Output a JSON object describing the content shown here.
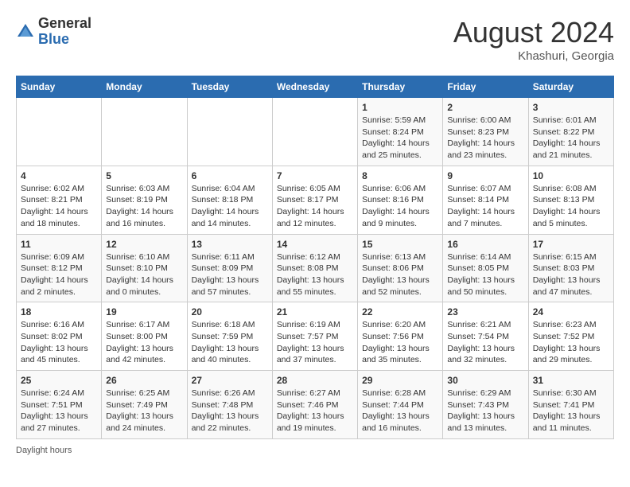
{
  "header": {
    "logo_general": "General",
    "logo_blue": "Blue",
    "month_year": "August 2024",
    "location": "Khashuri, Georgia"
  },
  "days_of_week": [
    "Sunday",
    "Monday",
    "Tuesday",
    "Wednesday",
    "Thursday",
    "Friday",
    "Saturday"
  ],
  "weeks": [
    [
      {
        "day": "",
        "sunrise": "",
        "sunset": "",
        "daylight": ""
      },
      {
        "day": "",
        "sunrise": "",
        "sunset": "",
        "daylight": ""
      },
      {
        "day": "",
        "sunrise": "",
        "sunset": "",
        "daylight": ""
      },
      {
        "day": "",
        "sunrise": "",
        "sunset": "",
        "daylight": ""
      },
      {
        "day": "1",
        "sunrise": "Sunrise: 5:59 AM",
        "sunset": "Sunset: 8:24 PM",
        "daylight": "Daylight: 14 hours and 25 minutes."
      },
      {
        "day": "2",
        "sunrise": "Sunrise: 6:00 AM",
        "sunset": "Sunset: 8:23 PM",
        "daylight": "Daylight: 14 hours and 23 minutes."
      },
      {
        "day": "3",
        "sunrise": "Sunrise: 6:01 AM",
        "sunset": "Sunset: 8:22 PM",
        "daylight": "Daylight: 14 hours and 21 minutes."
      }
    ],
    [
      {
        "day": "4",
        "sunrise": "Sunrise: 6:02 AM",
        "sunset": "Sunset: 8:21 PM",
        "daylight": "Daylight: 14 hours and 18 minutes."
      },
      {
        "day": "5",
        "sunrise": "Sunrise: 6:03 AM",
        "sunset": "Sunset: 8:19 PM",
        "daylight": "Daylight: 14 hours and 16 minutes."
      },
      {
        "day": "6",
        "sunrise": "Sunrise: 6:04 AM",
        "sunset": "Sunset: 8:18 PM",
        "daylight": "Daylight: 14 hours and 14 minutes."
      },
      {
        "day": "7",
        "sunrise": "Sunrise: 6:05 AM",
        "sunset": "Sunset: 8:17 PM",
        "daylight": "Daylight: 14 hours and 12 minutes."
      },
      {
        "day": "8",
        "sunrise": "Sunrise: 6:06 AM",
        "sunset": "Sunset: 8:16 PM",
        "daylight": "Daylight: 14 hours and 9 minutes."
      },
      {
        "day": "9",
        "sunrise": "Sunrise: 6:07 AM",
        "sunset": "Sunset: 8:14 PM",
        "daylight": "Daylight: 14 hours and 7 minutes."
      },
      {
        "day": "10",
        "sunrise": "Sunrise: 6:08 AM",
        "sunset": "Sunset: 8:13 PM",
        "daylight": "Daylight: 14 hours and 5 minutes."
      }
    ],
    [
      {
        "day": "11",
        "sunrise": "Sunrise: 6:09 AM",
        "sunset": "Sunset: 8:12 PM",
        "daylight": "Daylight: 14 hours and 2 minutes."
      },
      {
        "day": "12",
        "sunrise": "Sunrise: 6:10 AM",
        "sunset": "Sunset: 8:10 PM",
        "daylight": "Daylight: 14 hours and 0 minutes."
      },
      {
        "day": "13",
        "sunrise": "Sunrise: 6:11 AM",
        "sunset": "Sunset: 8:09 PM",
        "daylight": "Daylight: 13 hours and 57 minutes."
      },
      {
        "day": "14",
        "sunrise": "Sunrise: 6:12 AM",
        "sunset": "Sunset: 8:08 PM",
        "daylight": "Daylight: 13 hours and 55 minutes."
      },
      {
        "day": "15",
        "sunrise": "Sunrise: 6:13 AM",
        "sunset": "Sunset: 8:06 PM",
        "daylight": "Daylight: 13 hours and 52 minutes."
      },
      {
        "day": "16",
        "sunrise": "Sunrise: 6:14 AM",
        "sunset": "Sunset: 8:05 PM",
        "daylight": "Daylight: 13 hours and 50 minutes."
      },
      {
        "day": "17",
        "sunrise": "Sunrise: 6:15 AM",
        "sunset": "Sunset: 8:03 PM",
        "daylight": "Daylight: 13 hours and 47 minutes."
      }
    ],
    [
      {
        "day": "18",
        "sunrise": "Sunrise: 6:16 AM",
        "sunset": "Sunset: 8:02 PM",
        "daylight": "Daylight: 13 hours and 45 minutes."
      },
      {
        "day": "19",
        "sunrise": "Sunrise: 6:17 AM",
        "sunset": "Sunset: 8:00 PM",
        "daylight": "Daylight: 13 hours and 42 minutes."
      },
      {
        "day": "20",
        "sunrise": "Sunrise: 6:18 AM",
        "sunset": "Sunset: 7:59 PM",
        "daylight": "Daylight: 13 hours and 40 minutes."
      },
      {
        "day": "21",
        "sunrise": "Sunrise: 6:19 AM",
        "sunset": "Sunset: 7:57 PM",
        "daylight": "Daylight: 13 hours and 37 minutes."
      },
      {
        "day": "22",
        "sunrise": "Sunrise: 6:20 AM",
        "sunset": "Sunset: 7:56 PM",
        "daylight": "Daylight: 13 hours and 35 minutes."
      },
      {
        "day": "23",
        "sunrise": "Sunrise: 6:21 AM",
        "sunset": "Sunset: 7:54 PM",
        "daylight": "Daylight: 13 hours and 32 minutes."
      },
      {
        "day": "24",
        "sunrise": "Sunrise: 6:23 AM",
        "sunset": "Sunset: 7:52 PM",
        "daylight": "Daylight: 13 hours and 29 minutes."
      }
    ],
    [
      {
        "day": "25",
        "sunrise": "Sunrise: 6:24 AM",
        "sunset": "Sunset: 7:51 PM",
        "daylight": "Daylight: 13 hours and 27 minutes."
      },
      {
        "day": "26",
        "sunrise": "Sunrise: 6:25 AM",
        "sunset": "Sunset: 7:49 PM",
        "daylight": "Daylight: 13 hours and 24 minutes."
      },
      {
        "day": "27",
        "sunrise": "Sunrise: 6:26 AM",
        "sunset": "Sunset: 7:48 PM",
        "daylight": "Daylight: 13 hours and 22 minutes."
      },
      {
        "day": "28",
        "sunrise": "Sunrise: 6:27 AM",
        "sunset": "Sunset: 7:46 PM",
        "daylight": "Daylight: 13 hours and 19 minutes."
      },
      {
        "day": "29",
        "sunrise": "Sunrise: 6:28 AM",
        "sunset": "Sunset: 7:44 PM",
        "daylight": "Daylight: 13 hours and 16 minutes."
      },
      {
        "day": "30",
        "sunrise": "Sunrise: 6:29 AM",
        "sunset": "Sunset: 7:43 PM",
        "daylight": "Daylight: 13 hours and 13 minutes."
      },
      {
        "day": "31",
        "sunrise": "Sunrise: 6:30 AM",
        "sunset": "Sunset: 7:41 PM",
        "daylight": "Daylight: 13 hours and 11 minutes."
      }
    ]
  ],
  "footer": {
    "daylight_hours": "Daylight hours"
  }
}
